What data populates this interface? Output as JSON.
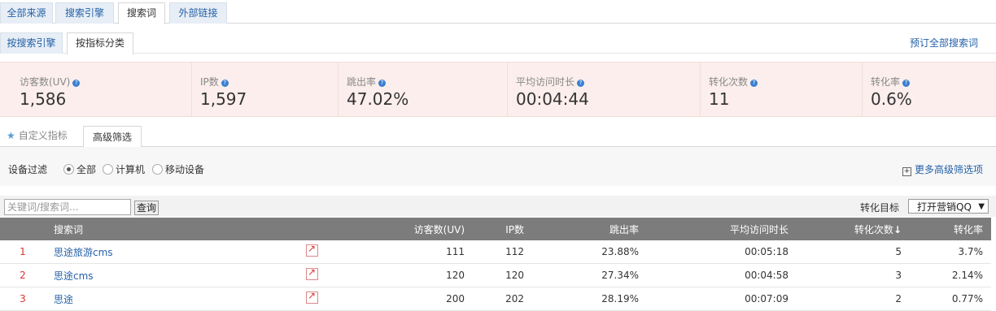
{
  "top_tabs": [
    {
      "label": "全部来源"
    },
    {
      "label": "搜索引擎"
    },
    {
      "label": "搜索词"
    },
    {
      "label": "外部链接"
    }
  ],
  "sub_tabs": [
    {
      "label": "按搜索引擎"
    },
    {
      "label": "按指标分类"
    }
  ],
  "subscribe_link": "预订全部搜索词",
  "metrics": [
    {
      "label": "访客数(UV)",
      "value": "1,586"
    },
    {
      "label": "IP数",
      "value": "1,597"
    },
    {
      "label": "跳出率",
      "value": "47.02%"
    },
    {
      "label": "平均访问时长",
      "value": "00:04:44"
    },
    {
      "label": "转化次数",
      "value": "11"
    },
    {
      "label": "转化率",
      "value": "0.6%"
    }
  ],
  "filter_tabs": {
    "custom": "自定义指标",
    "advanced": "高级筛选"
  },
  "device_filter": {
    "label": "设备过滤",
    "options": [
      "全部",
      "计算机",
      "移动设备"
    ],
    "selected": "全部"
  },
  "more_filters": "更多高级筛选项",
  "search": {
    "placeholder": "关键词/搜索词...",
    "button": "查询"
  },
  "conversion": {
    "label": "转化目标",
    "selected": "打开营销QQ"
  },
  "table": {
    "headers": [
      "搜索词",
      "访客数(UV)",
      "IP数",
      "跳出率",
      "平均访问时长",
      "转化次数",
      "转化率"
    ],
    "sort_icon": "arrow-down-icon",
    "rows": [
      {
        "rank": "1",
        "keyword": "思途旅游cms",
        "uv": "111",
        "ip": "112",
        "bounce": "23.88%",
        "duration": "00:05:18",
        "conversions": "5",
        "rate": "3.7%"
      },
      {
        "rank": "2",
        "keyword": "思途cms",
        "uv": "120",
        "ip": "120",
        "bounce": "27.34%",
        "duration": "00:04:58",
        "conversions": "3",
        "rate": "2.14%"
      },
      {
        "rank": "3",
        "keyword": "思途",
        "uv": "200",
        "ip": "202",
        "bounce": "28.19%",
        "duration": "00:07:09",
        "conversions": "2",
        "rate": "0.77%"
      }
    ]
  }
}
